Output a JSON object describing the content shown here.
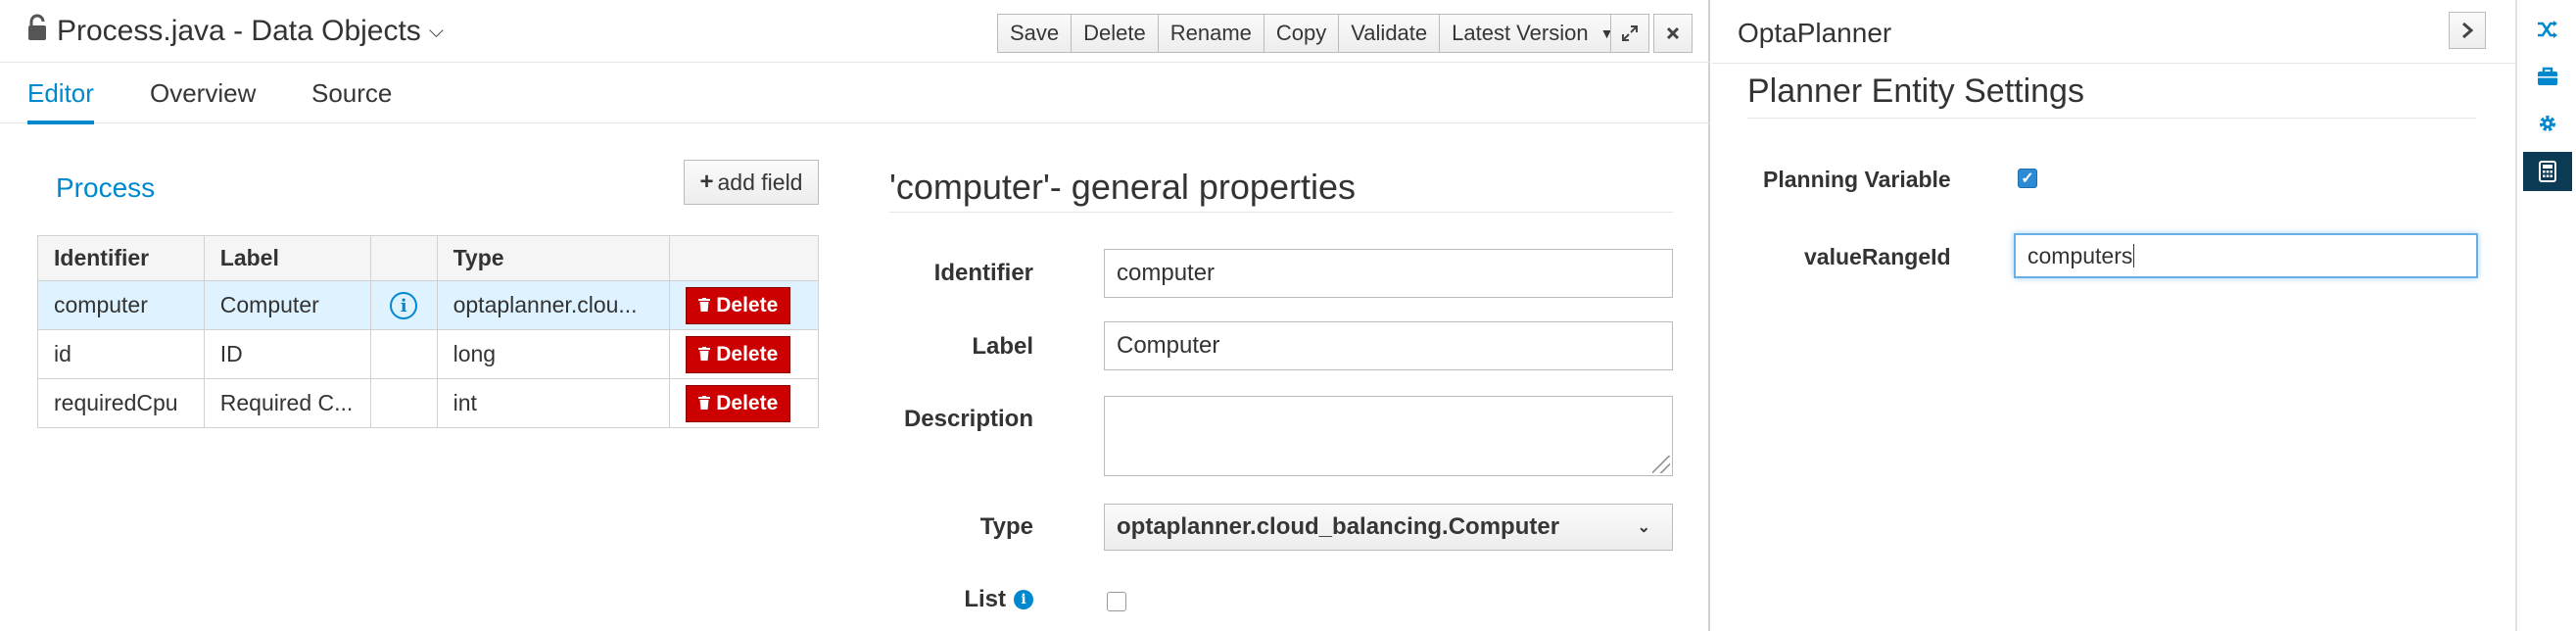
{
  "header": {
    "title": "Process.java - Data Objects",
    "toolbar": [
      "Save",
      "Delete",
      "Rename",
      "Copy",
      "Validate"
    ],
    "version_label": "Latest Version"
  },
  "tabs": [
    {
      "label": "Editor",
      "active": true
    },
    {
      "label": "Overview",
      "active": false
    },
    {
      "label": "Source",
      "active": false
    }
  ],
  "fields": {
    "title": "Process",
    "add_label": "add field",
    "columns": [
      "Identifier",
      "Label",
      "",
      "Type",
      ""
    ],
    "delete_label": "Delete",
    "rows": [
      {
        "identifier": "computer",
        "label": "Computer",
        "type": "optaplanner.clou...",
        "selected": true,
        "has_info": true
      },
      {
        "identifier": "id",
        "label": "ID",
        "type": "long",
        "selected": false,
        "has_info": false
      },
      {
        "identifier": "requiredCpu",
        "label": "Required C...",
        "type": "int",
        "selected": false,
        "has_info": false
      }
    ]
  },
  "properties": {
    "heading": "'computer'- general properties",
    "identifier_label": "Identifier",
    "identifier_value": "computer",
    "label_label": "Label",
    "label_value": "Computer",
    "description_label": "Description",
    "type_label": "Type",
    "type_value": "optaplanner.cloud_balancing.Computer",
    "list_label": "List",
    "list_checked": false
  },
  "optaplanner": {
    "title": "OptaPlanner",
    "heading": "Planner Entity Settings",
    "planning_variable_label": "Planning Variable",
    "planning_variable_checked": true,
    "value_range_label": "valueRangeId",
    "value_range_value": "computers"
  },
  "colors": {
    "accent": "#0088ce",
    "delete": "#cc0000",
    "selected_row": "#def3ff",
    "rail_active": "#0c3b55"
  },
  "icons": {
    "lock": "lock-icon",
    "rail": [
      "shuffle-icon",
      "briefcase-icon",
      "gear-icon",
      "calculator-icon"
    ]
  }
}
